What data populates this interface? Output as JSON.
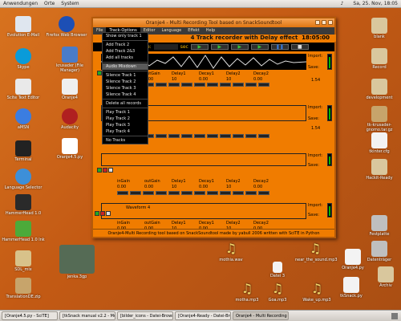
{
  "topbar": {
    "menu_apps": "Anwendungen",
    "menu_places": "Orte",
    "menu_system": "System",
    "datetime": "Sa, 25. Nov, 18:05"
  },
  "desktop_icons_left": [
    {
      "label": "Evolution E-Mail"
    },
    {
      "label": "Firefox Web Browser"
    },
    {
      "label": "Skype"
    },
    {
      "label": "krusader (File Manager)"
    },
    {
      "label": "Scite Text Editor"
    },
    {
      "label": "Oranje4"
    },
    {
      "label": "aMSN"
    },
    {
      "label": "Audacity"
    },
    {
      "label": "Terminal"
    },
    {
      "label": "Oranje4.5.py"
    },
    {
      "label": "Language Selector"
    },
    {
      "label": "HammerHead 1.0"
    },
    {
      "label": "HammerHead 1.0 lnk"
    },
    {
      "label": "SDL_mix"
    },
    {
      "label": "TranslationDE.zip"
    },
    {
      "label": "jenka.3gp"
    }
  ],
  "desktop_icons_right": [
    {
      "label": "blank"
    },
    {
      "label": "Record"
    },
    {
      "label": "development"
    },
    {
      "label": "tk-krusader-gnomo.tar.gz"
    },
    {
      "label": "tkinter.cfg"
    },
    {
      "label": "Hackit-Ready"
    },
    {
      "label": "Festplatte"
    },
    {
      "label": "Datenträger"
    },
    {
      "label": "Oranje4.py"
    },
    {
      "label": "tkSnack.py"
    },
    {
      "label": "Archiv"
    }
  ],
  "desktop_files_bottom": [
    {
      "label": "mothia.wav"
    },
    {
      "label": "near_the_sound.mp3"
    },
    {
      "label": "motha.mp3"
    },
    {
      "label": "Goa.mp3"
    },
    {
      "label": "Datei 3"
    },
    {
      "label": "Wake_up.mp3"
    }
  ],
  "window": {
    "title": "Oranje4 - Multi Recording Tool based on SnackSoundtool",
    "menu": [
      "File",
      "Track-Options",
      "Editor",
      "Language",
      "Effekt",
      "Help"
    ],
    "headline": "4 Track recorder with Delay effect",
    "clock": "18:05:00",
    "time_label": "Time:",
    "sec_label": "sec",
    "status": "Oranje4-Multi Recording tool based on SnackSoundtool made by yabull 2006  written with SciTE in Python"
  },
  "dropdown": [
    "Show only track 1",
    "---",
    "Add Track 2",
    "Add Track 2&3",
    "Add all tracks",
    "---",
    "Audio Mixdown",
    "---",
    "Silence Track 1",
    "Silence Track 2",
    "Silence Track 3",
    "Silence Track 4",
    "---",
    "Delete all records",
    "---",
    "Play Track 1",
    "Play Track 2",
    "Play Track 3",
    "Play Track 4",
    "---",
    "No Tracks"
  ],
  "track_params": {
    "labels": [
      "inGain",
      "outGain",
      "Delay1",
      "Decay1",
      "Delay2",
      "Decay2"
    ],
    "values": [
      "0.00",
      "0.00",
      "10",
      "0.00",
      "10",
      "0.00"
    ]
  },
  "track_side": {
    "import_label": "Import:",
    "save_label": "Save:",
    "vol_label": "Vol",
    "vol_value": "1.54"
  },
  "track4_label": "Waveform 4",
  "taskbar": [
    "[Oranje4.5.py - SciTE]",
    "[tkSnack manual v2.2 - Mo...",
    "[bilder_icons - Datei-Brows...",
    "[Oranje4-Ready - Datei-Bro...",
    "Oranje4 - Multi Recording T..."
  ],
  "colors": {
    "window_bg": "#f07c00",
    "wave": "#000000",
    "accent_green": "#35c435"
  }
}
